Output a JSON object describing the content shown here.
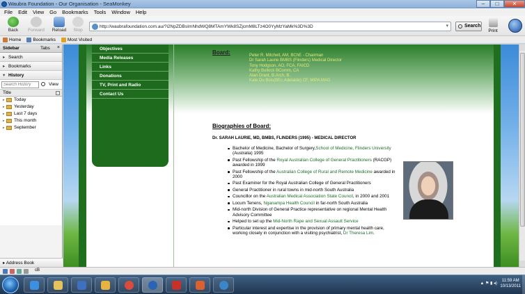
{
  "window": {
    "title": "Waubra Foundation - Our Organisation - SeaMonkey"
  },
  "menu": [
    "File",
    "Edit",
    "View",
    "Go",
    "Bookmarks",
    "Tools",
    "Window",
    "Help"
  ],
  "nav": {
    "back": "Back",
    "forward": "Forward",
    "reload": "Reload",
    "stop": "Stop",
    "search": "Search",
    "print": "Print"
  },
  "url": "http://waubrafoundation.com.au/?i2NpZDBsImNhdWQ8MTAmYWk8SZjcmM8LTz4O0YyMzYaMk%3D%3D",
  "bookmarks": [
    "Home",
    "Bookmarks",
    "Most Visited"
  ],
  "sidebar": {
    "title": "Sidebar",
    "tabs": "Tabs",
    "sections": [
      "Search",
      "Bookmarks",
      "History"
    ],
    "search_placeholder": "Search History",
    "view": "View",
    "col_title": "Title",
    "history": [
      "Today",
      "Yesterday",
      "Last 7 days",
      "This month",
      "September"
    ],
    "bottom": "Address Book"
  },
  "site_nav": [
    "Objectives",
    "Media Releases",
    "Links",
    "Donations",
    "TV, Print and Radio",
    "Contact Us"
  ],
  "board": {
    "heading": "Board:",
    "members": [
      "Peter R. Mitchell, AM, BChE - Chairman",
      "Dr Sarah Laurie BMBS (Flinders) Medical Director",
      "Tony Hodgson, AO, FCA, FAICD",
      "Kathy Bullock BComm, CA",
      "Alan Grant, B.Arch, B.",
      "Kate Du Bois(BEc,Adelaide) CF, MIPA MAG"
    ]
  },
  "bio": {
    "heading": "Biographies of Board:",
    "subheading": "Dr. SARAH LAURIE, MD, BMBS, FLINDERS (1995) - MEDICAL DIRECTOR",
    "items": [
      {
        "parts": [
          {
            "t": "Bachelor of Medicine, Bachelor of Surgery,"
          },
          {
            "t": "School of Medicine, Flinders University",
            "link": true
          },
          {
            "t": " (Australia) 1995"
          }
        ]
      },
      {
        "parts": [
          {
            "t": "Past Fellowship of the "
          },
          {
            "t": "Royal Australian College of General Practitioners",
            "link": true
          },
          {
            "t": " (RACGP) awarded in 1999"
          }
        ]
      },
      {
        "parts": [
          {
            "t": "Past Fellowship of the "
          },
          {
            "t": "Australian College of Rural and Remote Medicine",
            "link": true
          },
          {
            "t": " awarded in 2000"
          }
        ]
      },
      {
        "parts": [
          {
            "t": "Past Examiner for the Royal Australian College of General Practitioners"
          }
        ]
      },
      {
        "parts": [
          {
            "t": "General Practitioner in rural towns in mid-north South Australia"
          }
        ]
      },
      {
        "parts": [
          {
            "t": "Councillor on the "
          },
          {
            "t": "Australian Medical Association State Council",
            "link": true
          },
          {
            "t": ", in 2000 and 2001"
          }
        ]
      },
      {
        "parts": [
          {
            "t": "Locum Tenens, "
          },
          {
            "t": "Nganampa Health Council",
            "link": true
          },
          {
            "t": " in far-north South Australia"
          }
        ]
      },
      {
        "parts": [
          {
            "t": "Mid-north Division of General Practice representative on regional Mental Health Advisory Committee"
          }
        ]
      },
      {
        "parts": [
          {
            "t": "Helped to set up the "
          },
          {
            "t": "Mid-North Rape and Sexual Assault Service",
            "link": true
          }
        ]
      },
      {
        "parts": [
          {
            "t": "Particular interest and expertise in the provision of primary mental health care, working closely in conjunction with a visiting psychiatrist, "
          },
          {
            "t": "Dr Theresa Lim",
            "link": true
          },
          {
            "t": "."
          }
        ]
      }
    ]
  },
  "statusbar": {
    "text": "cB"
  },
  "taskbar": {
    "time": "11:59 AM",
    "date": "10/13/2011"
  },
  "colors": {
    "site_green": "#1e6b1e",
    "board_text": "#e2ea7a",
    "link": "#1e6e2a"
  }
}
